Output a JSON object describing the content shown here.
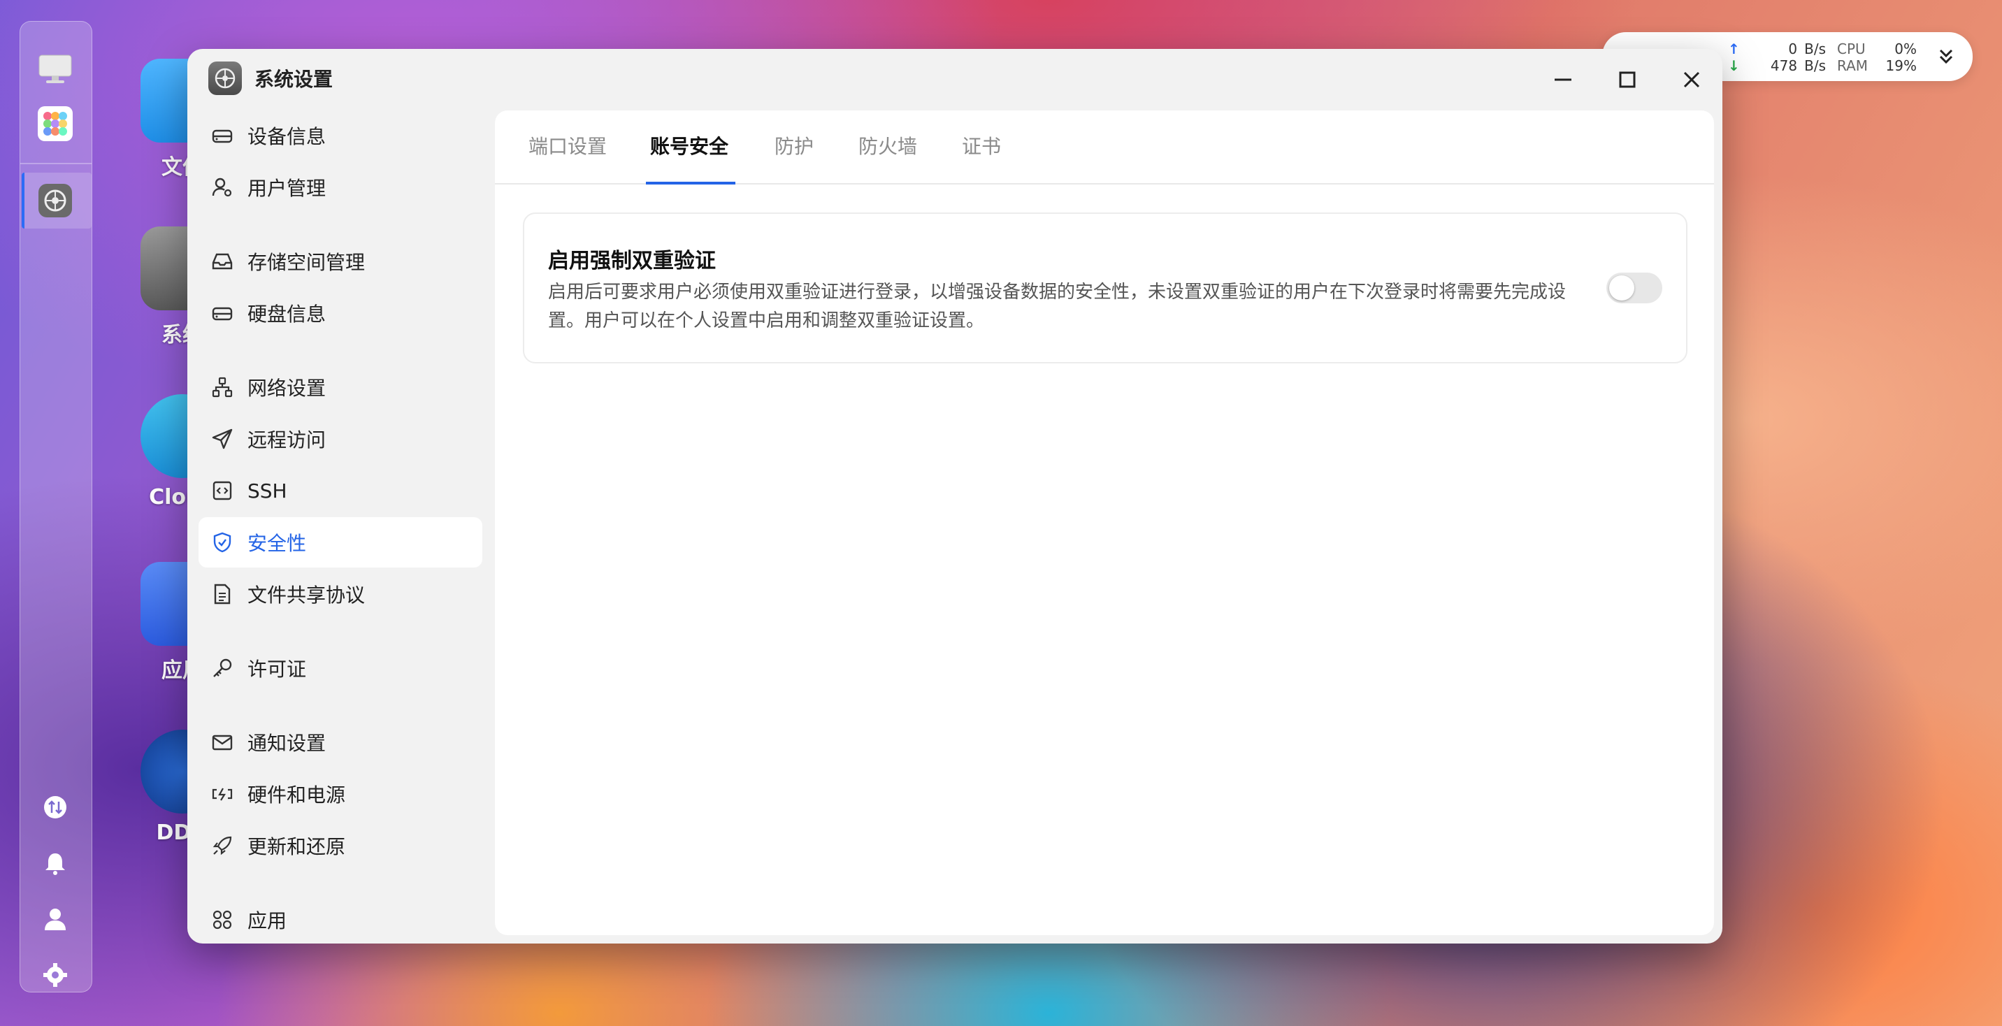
{
  "desktop": {
    "icons": [
      {
        "label": "文件"
      },
      {
        "label": "系统"
      },
      {
        "label": "Cloud"
      },
      {
        "label": "应用"
      },
      {
        "label": "DDN"
      }
    ]
  },
  "netwidget": {
    "up_value": "0",
    "up_unit": "B/s",
    "down_value": "478",
    "down_unit": "B/s",
    "cpu_label": "CPU",
    "cpu_value": "0%",
    "ram_label": "RAM",
    "ram_value": "19%"
  },
  "window": {
    "title": "系统设置"
  },
  "sidebar": {
    "items": [
      {
        "label": "设备信息",
        "icon": "drive-icon"
      },
      {
        "label": "用户管理",
        "icon": "user-gear-icon"
      },
      {
        "label": "存储空间管理",
        "icon": "inbox-icon"
      },
      {
        "label": "硬盘信息",
        "icon": "drive-icon"
      },
      {
        "label": "网络设置",
        "icon": "network-icon"
      },
      {
        "label": "远程访问",
        "icon": "send-icon"
      },
      {
        "label": "SSH",
        "icon": "code-icon"
      },
      {
        "label": "安全性",
        "icon": "shield-icon",
        "active": true
      },
      {
        "label": "文件共享协议",
        "icon": "file-icon"
      },
      {
        "label": "许可证",
        "icon": "key-icon"
      },
      {
        "label": "通知设置",
        "icon": "mail-icon"
      },
      {
        "label": "硬件和电源",
        "icon": "battery-icon"
      },
      {
        "label": "更新和还原",
        "icon": "rocket-icon"
      },
      {
        "label": "应用",
        "icon": "apps-icon"
      }
    ]
  },
  "tabs": [
    {
      "label": "端口设置"
    },
    {
      "label": "账号安全",
      "active": true
    },
    {
      "label": "防护"
    },
    {
      "label": "防火墙"
    },
    {
      "label": "证书"
    }
  ],
  "card": {
    "title": "启用强制双重验证",
    "description": "启用后可要求用户必须使用双重验证进行登录，以增强设备数据的安全性，未设置双重验证的用户在下次登录时将需要先完成设置。用户可以在个人设置中启用和调整双重验证设置。",
    "toggle_on": false
  },
  "colors": {
    "accent": "#2464e6"
  }
}
